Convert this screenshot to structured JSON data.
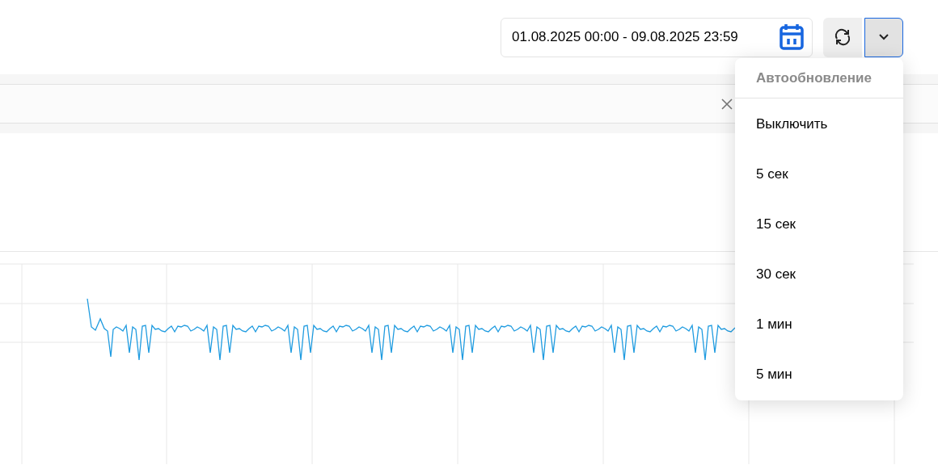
{
  "date_range": {
    "value": "01.08.2025 00:00 - 09.08.2025 23:59"
  },
  "refresh_dropdown": {
    "expanded": true
  },
  "autorefresh_menu": {
    "title": "Автообновление",
    "items": [
      {
        "label": "Выключить"
      },
      {
        "label": "5 сек"
      },
      {
        "label": "15 сек"
      },
      {
        "label": "30 сек"
      },
      {
        "label": "1 мин"
      },
      {
        "label": "5 мин"
      }
    ]
  }
}
